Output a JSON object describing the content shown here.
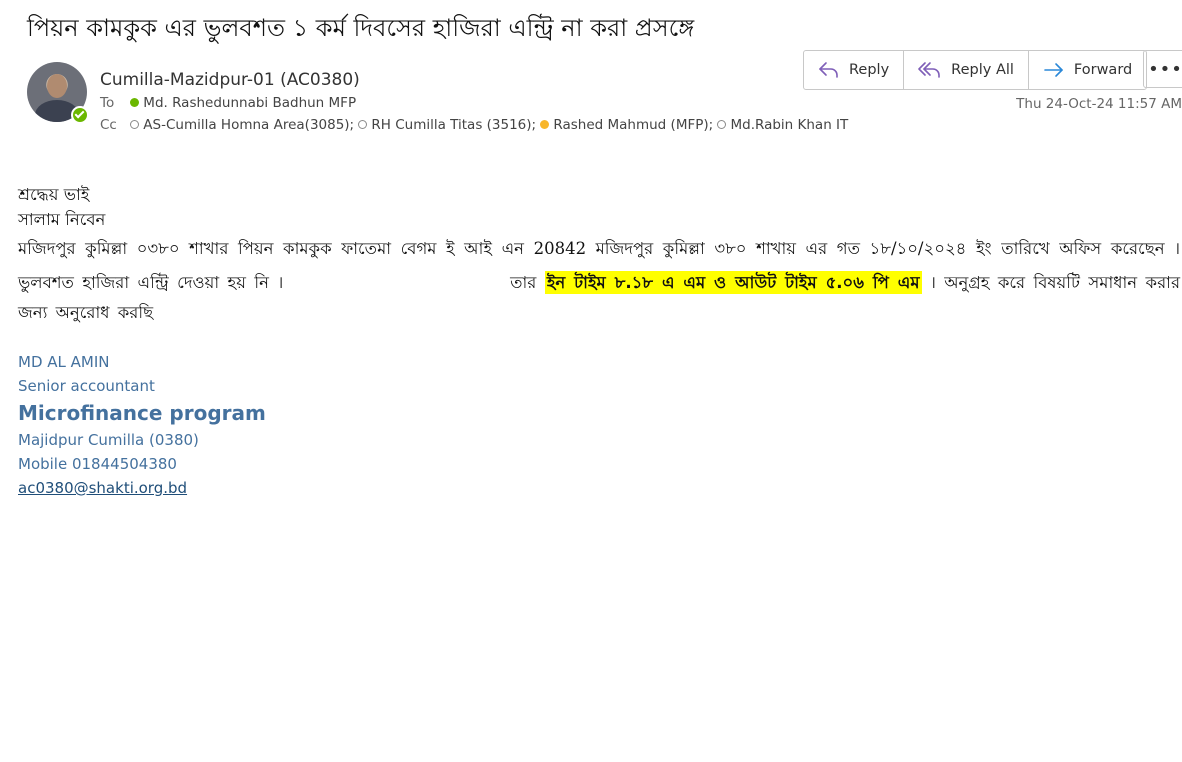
{
  "email": {
    "subject": "পিয়ন কামকুক এর ভুলবশত ১ কর্ম দিবসের হাজিরা এন্ট্রি না করা প্রসঙ্গে",
    "sender": "Cumilla-Mazidpur-01 (AC0380)",
    "to_label": "To",
    "to": [
      {
        "name": "Md. Rashedunnabi Badhun MFP",
        "status": "available"
      }
    ],
    "cc_label": "Cc",
    "cc": [
      {
        "name": "AS-Cumilla Homna Area(3085);",
        "status": "offline"
      },
      {
        "name": "RH Cumilla Titas (3516);",
        "status": "offline"
      },
      {
        "name": "Rashed Mahmud (MFP);",
        "status": "away"
      },
      {
        "name": "Md.Rabin Khan IT",
        "status": "offline"
      }
    ],
    "date": "Thu 24-Oct-24 11:57 AM"
  },
  "actions": {
    "reply": "Reply",
    "reply_all": "Reply All",
    "forward": "Forward",
    "more": "•••"
  },
  "body": {
    "greeting": "শ্রদ্ধেয় ভাই",
    "salam": "সালাম নিবেন",
    "line1": "মজিদপুর কুমিল্লা ০৩৮০ শাখার পিয়ন কামকুক ফাতেমা বেগম ই আই এন 20842 মজিদপুর কুমিল্লা ৩৮০ শাখায় এর গত ১৮/১০/২০২৪ ইং তারিখে অফিস",
    "line2_a": "করেছেন । ভুলবশত হাজিরা এন্ট্রি দেওয়া হয় নি ।",
    "line2_b": "তার",
    "highlight": "ইন টাইম ৮.১৮ এ এম ও আউট টাইম ৫.০৬ পি এম",
    "line2_c": "। অনুগ্রহ করে বিষয়টি",
    "line3": "সমাধান করার জন্য অনুরোধ করছি"
  },
  "signature": {
    "name": "MD AL AMIN",
    "title": "Senior accountant",
    "program": "Microfinance program",
    "branch": "Majidpur Cumilla (0380)",
    "mobile": "Mobile 01844504380",
    "email": "ac0380@shakti.org.bd"
  },
  "colors": {
    "available": "#6bb700",
    "away": "#f8b62b",
    "highlight": "#ffff00",
    "signature": "#44719e",
    "action_icon": "#7f5fb8"
  }
}
